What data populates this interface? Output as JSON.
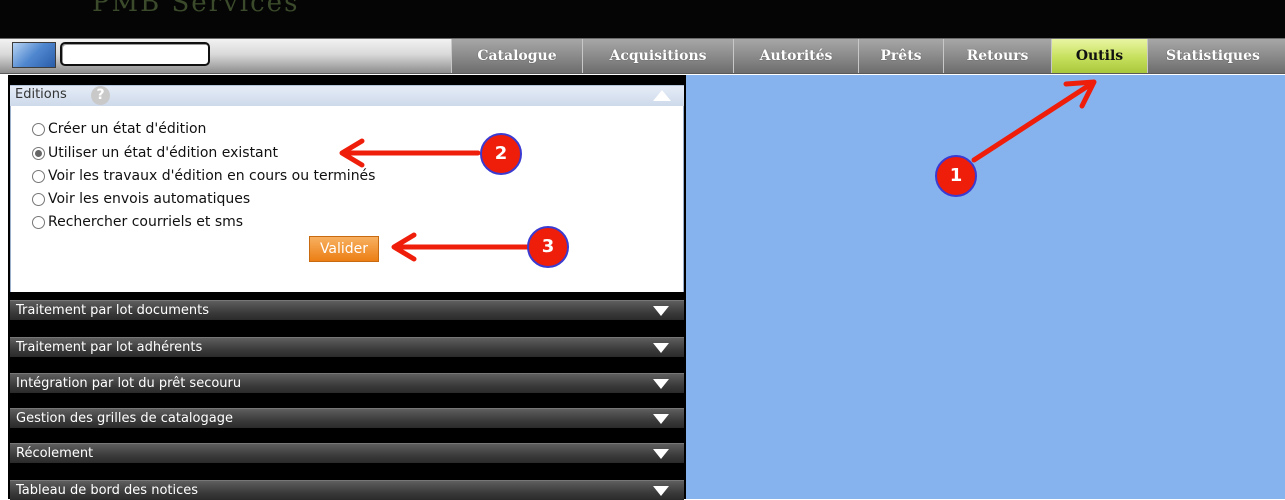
{
  "banner": {
    "title": "PMB Services"
  },
  "navbar": {
    "tabs": [
      {
        "label": "Catalogue"
      },
      {
        "label": "Acquisitions"
      },
      {
        "label": "Autorités"
      },
      {
        "label": "Prêts"
      },
      {
        "label": "Retours"
      },
      {
        "label": "Outils",
        "active": true
      },
      {
        "label": "Statistiques"
      }
    ],
    "active_color": "#c6e05c"
  },
  "editions": {
    "title": "Editions",
    "help_icon": "?",
    "options": [
      {
        "label": "Créer un état d'édition",
        "checked": false
      },
      {
        "label": "Utiliser un état d'édition existant",
        "checked": true
      },
      {
        "label": "Voir les travaux d'édition en cours ou terminés",
        "checked": false
      },
      {
        "label": "Voir les envois automatiques",
        "checked": false
      },
      {
        "label": "Rechercher courriels et sms",
        "checked": false
      }
    ],
    "submit_label": "Valider",
    "submit_color": "#ec7f14"
  },
  "sections": [
    {
      "label": "Traitement par lot documents"
    },
    {
      "label": "Traitement par lot adhérents"
    },
    {
      "label": "Intégration par lot du prêt secouru"
    },
    {
      "label": "Gestion des grilles de catalogage"
    },
    {
      "label": "Récolement"
    },
    {
      "label": "Tableau de bord des notices"
    }
  ],
  "annotations": [
    {
      "number": "1",
      "target": "Outils"
    },
    {
      "number": "2",
      "target": "Utiliser un état d'édition existant"
    },
    {
      "number": "3",
      "target": "Valider"
    }
  ],
  "colors": {
    "content_bg": "#86b3ee",
    "annotation": "#ef1e0b"
  }
}
